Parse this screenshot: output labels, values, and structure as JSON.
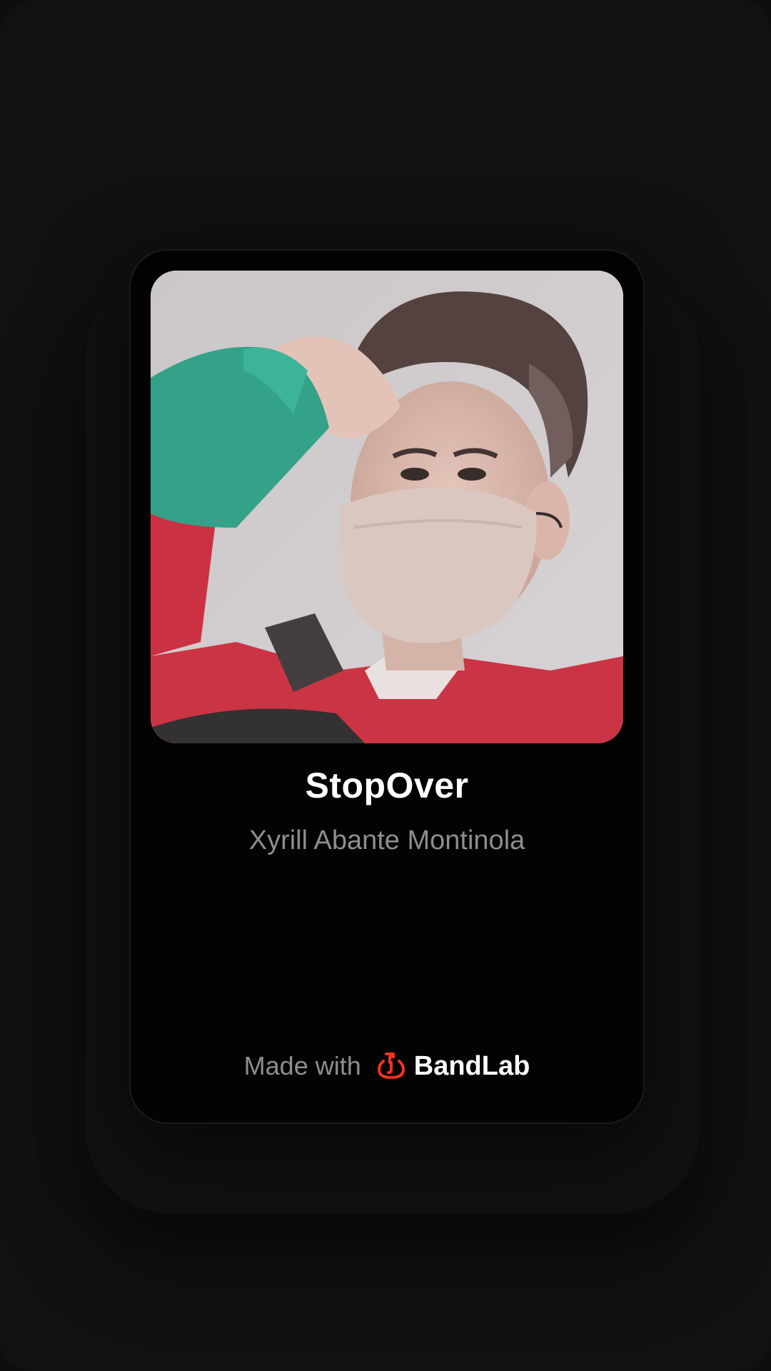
{
  "track": {
    "title": "StopOver",
    "artist": "Xyrill Abante Montinola"
  },
  "cover": {
    "description_icon": "profile-photo"
  },
  "footer": {
    "made_with_label": "Made with",
    "brand_name": "BandLab",
    "brand_icon": "bandlab-logo-icon"
  },
  "colors": {
    "background": "#111112",
    "card": "#030304",
    "title": "#ffffff",
    "subtitle": "#8d8d92",
    "brand_accent": "#f5331f"
  }
}
